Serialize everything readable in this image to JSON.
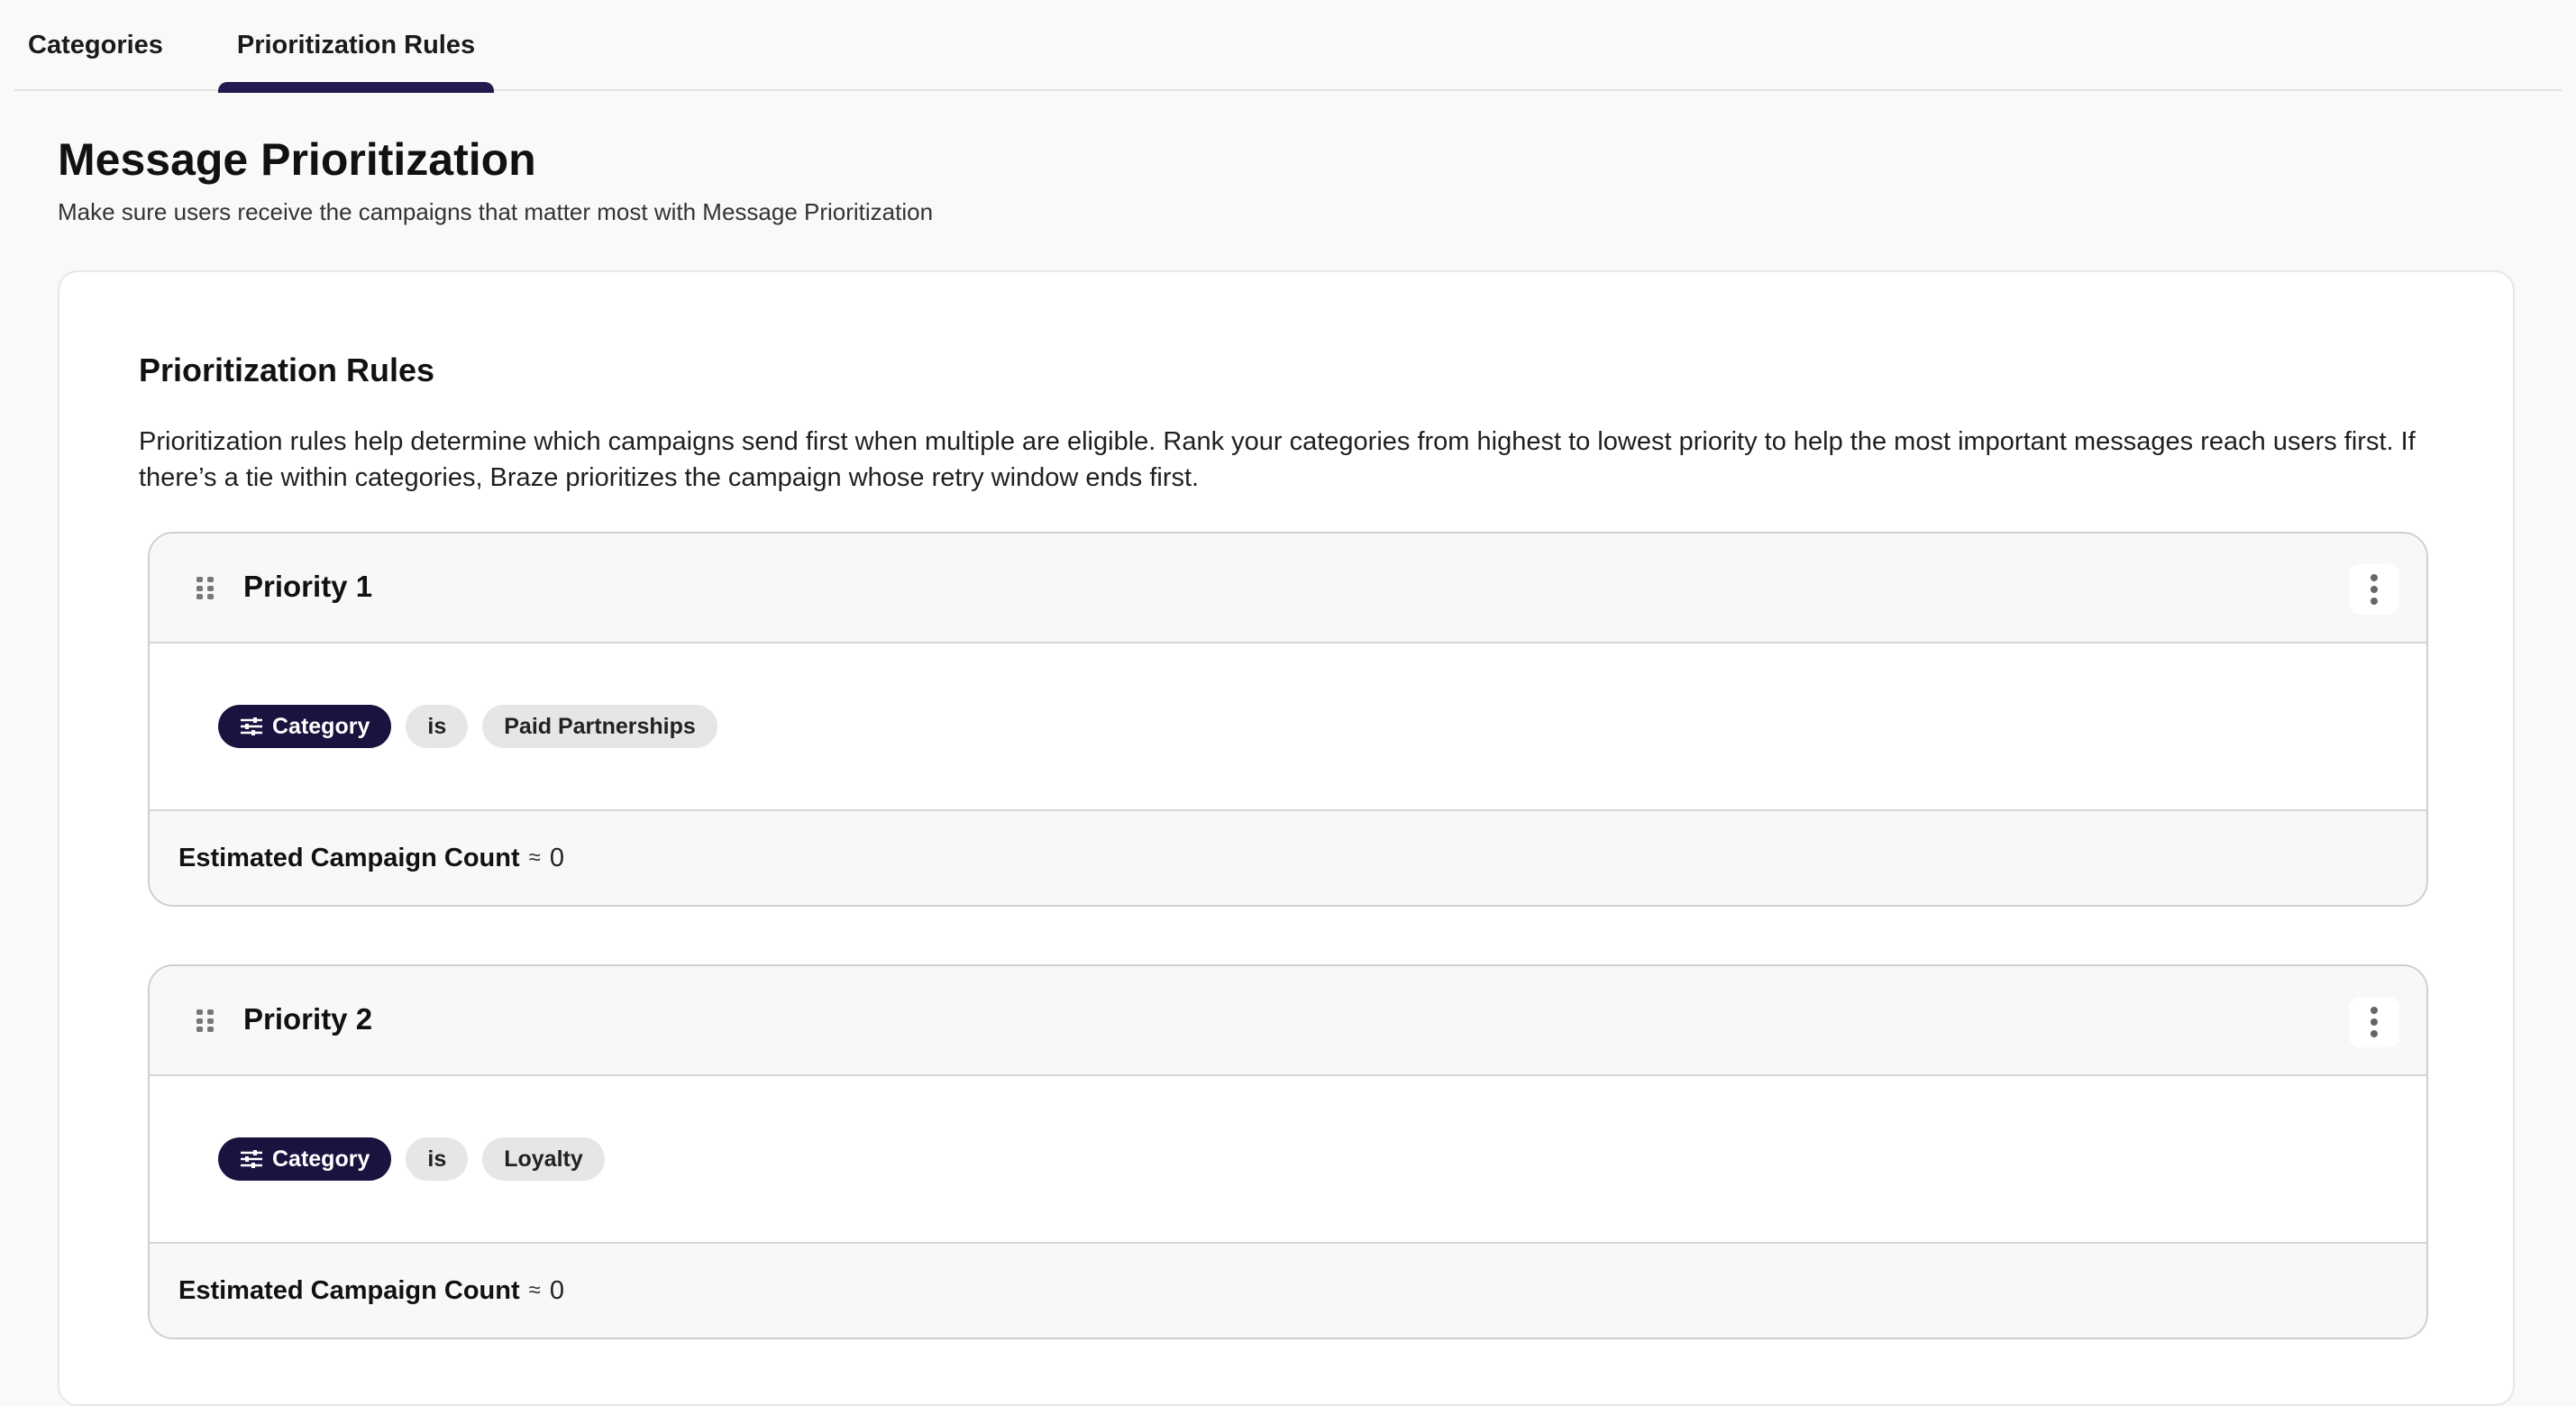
{
  "tabs": [
    {
      "label": "Categories",
      "active": false
    },
    {
      "label": "Prioritization Rules",
      "active": true
    }
  ],
  "header": {
    "title": "Message Prioritization",
    "subtitle": "Make sure users receive the campaigns that matter most with Message Prioritization"
  },
  "card": {
    "title": "Prioritization Rules",
    "description": "Prioritization rules help determine which campaigns send first when multiple are eligible. Rank your categories from highest to lowest priority to help the most important messages reach users first. If there’s a tie within categories, Braze prioritizes the campaign whose retry window ends first."
  },
  "rules": [
    {
      "title": "Priority 1",
      "field": "Category",
      "operator": "is",
      "value": "Paid Partnerships",
      "count_label": "Estimated Campaign Count",
      "approx": "≈",
      "count": "0"
    },
    {
      "title": "Priority 2",
      "field": "Category",
      "operator": "is",
      "value": "Loyalty",
      "count_label": "Estimated Campaign Count",
      "approx": "≈",
      "count": "0"
    }
  ],
  "icons": {
    "drag": "drag-handle-icon",
    "menu": "more-vertical-icon",
    "filter": "sliders-icon"
  },
  "colors": {
    "accent": "#231a4f",
    "chip_dark": "#1c1240"
  }
}
